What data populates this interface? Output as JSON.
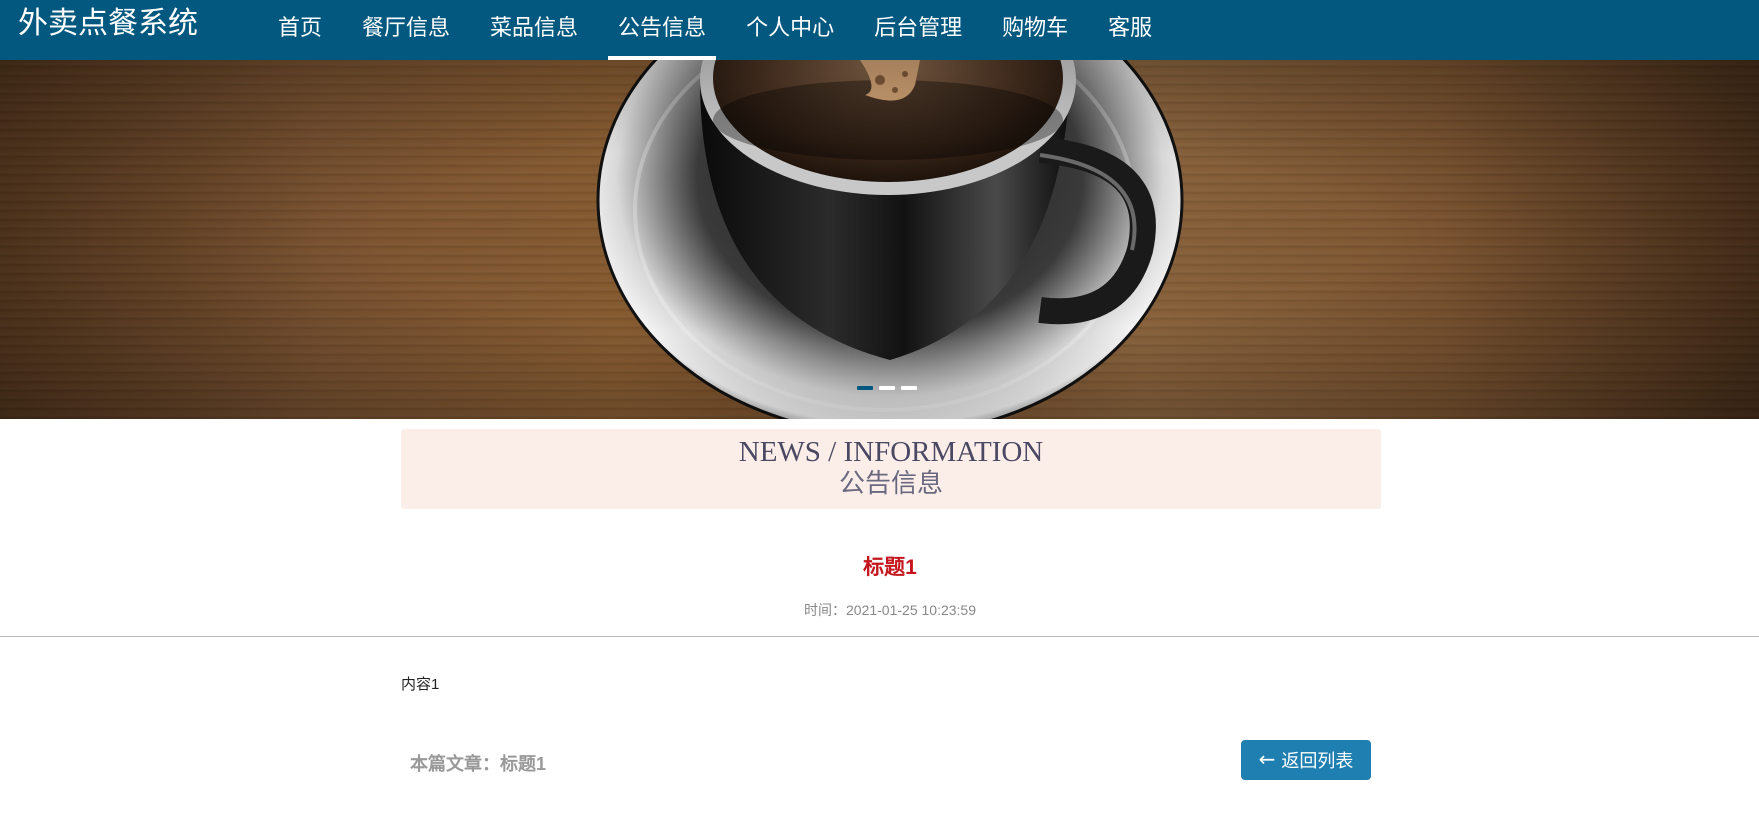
{
  "header": {
    "brand": "外卖点餐系统",
    "nav": [
      {
        "label": "首页"
      },
      {
        "label": "餐厅信息"
      },
      {
        "label": "菜品信息"
      },
      {
        "label": "公告信息",
        "active": true
      },
      {
        "label": "个人中心"
      },
      {
        "label": "后台管理"
      },
      {
        "label": "购物车"
      },
      {
        "label": "客服"
      }
    ],
    "bg_color": "#03587f"
  },
  "banner": {
    "image": "coffee-cup-on-saucer",
    "slides_count": 3,
    "active_slide": 1
  },
  "section": {
    "title_en": "NEWS / INFORMATION",
    "title_cn": "公告信息"
  },
  "article": {
    "title": "标题1",
    "time_label": "时间：",
    "time_value": "2021-01-25 10:23:59",
    "content": "内容1",
    "current_label": "本篇文章：",
    "current_title": "标题1",
    "back_label": "返回列表",
    "back_icon": "arrow-left-icon"
  },
  "colors": {
    "accent": "#03587f",
    "title_red": "#c4161c",
    "button_blue": "#1f7fb0",
    "section_bg": "#fbede7"
  }
}
